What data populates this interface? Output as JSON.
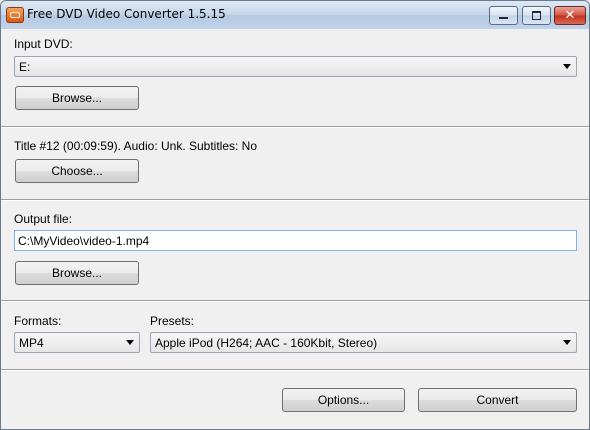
{
  "window": {
    "title": "Free DVD Video Converter 1.5.15",
    "minimize_label": "",
    "maximize_label": "",
    "close_label": "✕"
  },
  "input_dvd": {
    "label": "Input DVD:",
    "drive_value": "E:",
    "browse_label": "Browse..."
  },
  "title_info": {
    "text": "Title #12 (00:09:59).  Audio: Unk.  Subtitles: No",
    "choose_label": "Choose..."
  },
  "output": {
    "label": "Output file:",
    "path_value": "C:\\MyVideo\\video-1.mp4",
    "browse_label": "Browse..."
  },
  "formats": {
    "label": "Formats:",
    "selected": "MP4"
  },
  "presets": {
    "label": "Presets:",
    "selected": "Apple iPod (H264; AAC - 160Kbit, Stereo)"
  },
  "actions": {
    "options_label": "Options...",
    "convert_label": "Convert"
  },
  "icons": {
    "app": "dvd-app-icon",
    "dropdown": "chevron-down-icon"
  }
}
